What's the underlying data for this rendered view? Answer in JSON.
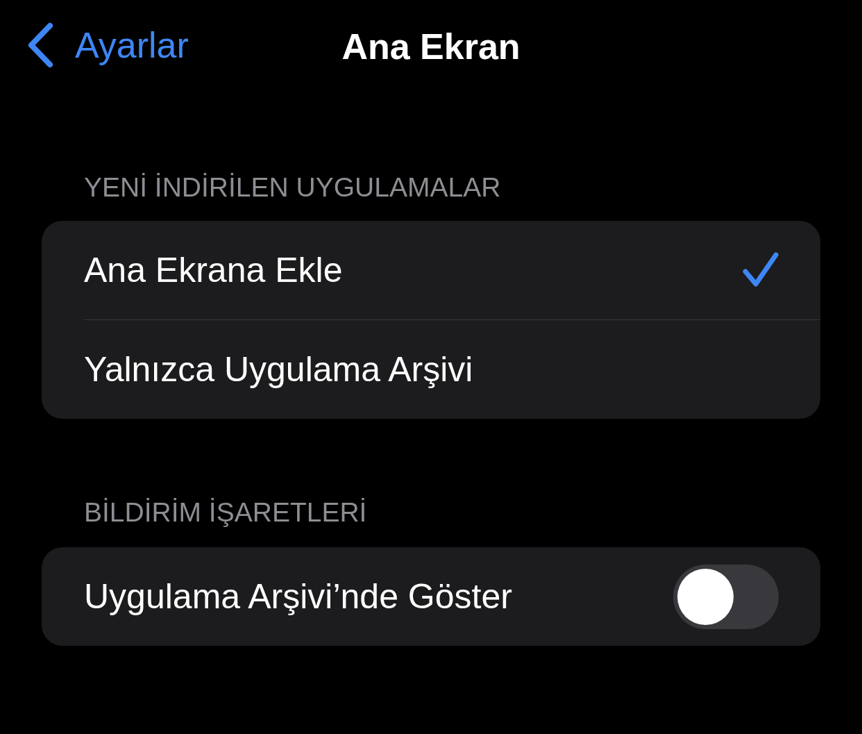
{
  "nav": {
    "back_label": "Ayarlar",
    "title": "Ana Ekran"
  },
  "sections": [
    {
      "header": "YENİ İNDİRİLEN UYGULAMALAR",
      "rows": [
        {
          "label": "Ana Ekrana Ekle",
          "kind": "choice",
          "selected": true
        },
        {
          "label": "Yalnızca Uygulama Arşivi",
          "kind": "choice",
          "selected": false
        }
      ]
    },
    {
      "header": "BİLDİRİM İŞARETLERİ",
      "rows": [
        {
          "label": "Uygulama Arşivi’nde Göster",
          "kind": "toggle",
          "on": false
        }
      ]
    }
  ]
}
